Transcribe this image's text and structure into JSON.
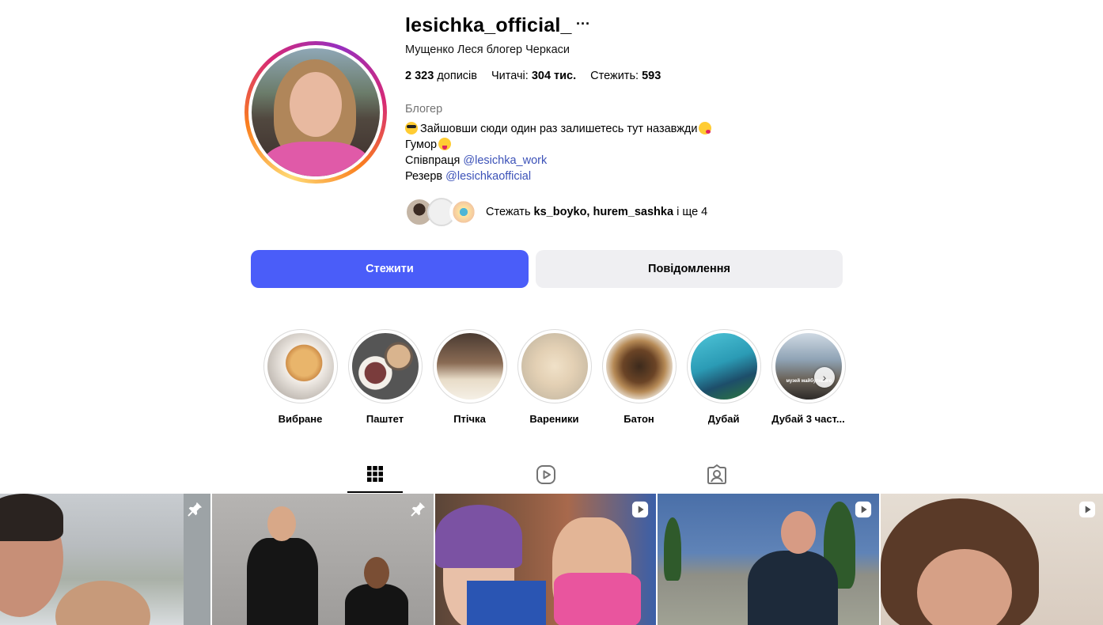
{
  "profile": {
    "username": "lesichka_official_",
    "more_label": "···",
    "full_name": "Мущенко Леся блогер Черкаси",
    "stats": {
      "posts_value": "2 323",
      "posts_label": "дописів",
      "followers_label": "Читачі:",
      "followers_value": "304 тис.",
      "following_label": "Стежить:",
      "following_value": "593"
    },
    "category": "Блогер",
    "bio": {
      "line1": "Зайшовши сюди один раз залишетесь тут назавжди",
      "line2": "Гумор",
      "line3_text": "Співпраця ",
      "line3_link": "@lesichka_work",
      "line4_text": "Резерв ",
      "line4_link": "@lesichkaofficial"
    },
    "followed_by": {
      "prefix": "Стежать ",
      "names": "ks_boyko, hurem_sashka",
      "suffix": " і ще 4"
    }
  },
  "actions": {
    "follow_label": "Стежити",
    "message_label": "Повідомлення"
  },
  "highlights": [
    {
      "label": "Вибране"
    },
    {
      "label": "Паштет"
    },
    {
      "label": "Птічка"
    },
    {
      "label": "Вареники"
    },
    {
      "label": "Батон"
    },
    {
      "label": "Дубай"
    },
    {
      "label": "Дубай 3 част...",
      "caption": "музей майбутнього"
    }
  ],
  "tabs": [
    {
      "name": "posts",
      "icon": "grid-icon",
      "active": true
    },
    {
      "name": "reels",
      "icon": "reels-icon",
      "active": false
    },
    {
      "name": "tagged",
      "icon": "tagged-icon",
      "active": false
    }
  ],
  "posts": [
    {
      "badge": "pin-icon"
    },
    {
      "badge": "pin-icon"
    },
    {
      "badge": "reel-icon"
    },
    {
      "badge": "reel-icon"
    },
    {
      "badge": "reel-icon"
    }
  ],
  "colors": {
    "primary_button": "#4a5df9",
    "secondary_button": "#efeff2",
    "link": "#3c52b8",
    "muted_text": "#737373"
  }
}
